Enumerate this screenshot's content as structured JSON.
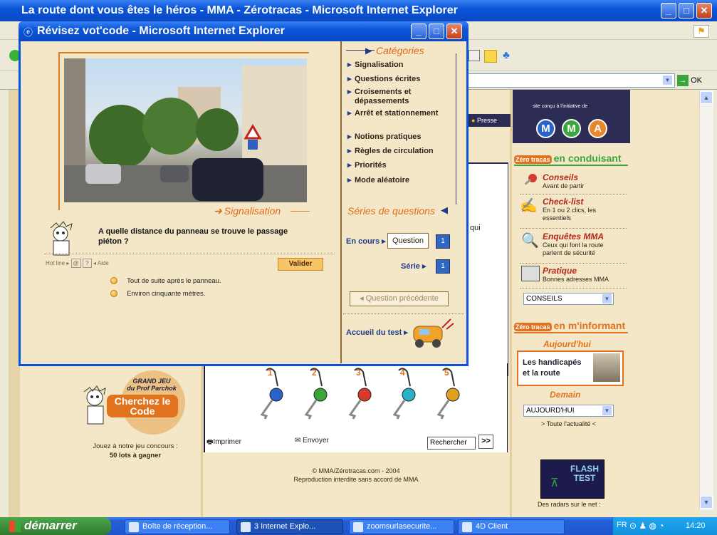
{
  "bg_window": {
    "title": "La route dont vous êtes le héros - MMA - Zérotracas - Microsoft Internet Explorer",
    "ok_label": "OK"
  },
  "popup": {
    "title": "Révisez vot'code - Microsoft Internet Explorer",
    "section_label": "Signalisation",
    "question": "A quelle distance du panneau se trouve le passage piéton ?",
    "hotline_label": "Hot line",
    "aide_label": "Aide",
    "valider_label": "Valider",
    "answers": [
      "Tout de suite après le panneau.",
      "Environ cinquante mètres."
    ],
    "categories_title": "Catégories",
    "categories": [
      "Signalisation",
      "Questions écrites",
      "Croisements et dépassements",
      "Arrêt et stationnement",
      "Notions pratiques",
      "Règles de circulation",
      "Priorités",
      "Mode aléatoire"
    ],
    "series_title": "Séries de questions",
    "en_cours_label": "En cours",
    "question_label": "Question",
    "question_number": "1",
    "serie_label": "Série",
    "serie_number": "1",
    "prev_question_label": "Question précédente",
    "accueil_label": "Accueil du test"
  },
  "site": {
    "presse_label": "Presse",
    "initiative_text": "site conçu à l'initiative de",
    "mma_letters": [
      "M",
      "M",
      "A"
    ],
    "conduisant_title": "en conduisant",
    "zero_tracas": "Zéro tracas",
    "menu": [
      {
        "title": "Conseils",
        "sub": "Avant de partir"
      },
      {
        "title": "Check-list",
        "sub": "En 1 ou 2 clics, les essentiels"
      },
      {
        "title": "Enquêtes MMA",
        "sub": "Ceux qui font la route parlent de sécurité"
      },
      {
        "title": "Pratique",
        "sub": "Bonnes adresses MMA"
      }
    ],
    "conseils_select": "CONSEILS",
    "informant_title": "en m'informant",
    "aujourdhui_title": "Aujourd'hui",
    "handicapes_text": "Les handicapés et la route",
    "demain_title": "Demain",
    "aujourdhui_select": "AUJOURD'HUI",
    "toute_actualite": "> Toute l'actualité <",
    "flash_test": "FLASH TEST",
    "radars_text": "Des radars sur le net :",
    "qui_text": "qui",
    "jeu_title1": "GRAND JEU",
    "jeu_title2": "du Prof Parchok",
    "jeu_title3": "Cherchez le Code",
    "jeu_text": "Jouez à notre jeu concours :",
    "jeu_lots": "50 lots à gagner",
    "keys": [
      "1",
      "2",
      "3",
      "4",
      "5"
    ],
    "imprimer_label": "Imprimer",
    "envoyer_label": "Envoyer",
    "rechercher_value": "Rechercher",
    "footer1": "© MMA/Zérotracas.com - 2004",
    "footer2": "Reproduction interdite sans accord de MMA"
  },
  "taskbar": {
    "start_label": "démarrer",
    "tasks": [
      "Boîte de réception...",
      "3 Internet Explo...",
      "zoomsurlasecurite...",
      "4D Client"
    ],
    "lang": "FR",
    "clock": "14:20"
  },
  "colors": {
    "beige": "#f4e7c8",
    "orange": "#e06a16",
    "navy": "#2d2c55",
    "xp_blue": "#0a55d8"
  }
}
